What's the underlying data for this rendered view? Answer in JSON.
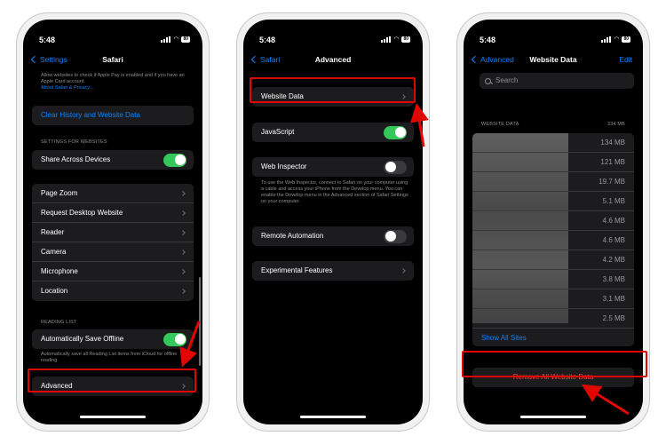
{
  "status": {
    "time": "5:48",
    "battery": "80"
  },
  "screen1": {
    "back_label": "Settings",
    "title": "Safari",
    "apple_pay_note": "Allow websites to check if Apple Pay is enabled and if you have an Apple Card account.",
    "apple_pay_link": "About Safari & Privacy…",
    "clear_history": "Clear History and Website Data",
    "settings_header": "SETTINGS FOR WEBSITES",
    "share_across_devices": "Share Across Devices",
    "website_items": [
      "Page Zoom",
      "Request Desktop Website",
      "Reader",
      "Camera",
      "Microphone",
      "Location"
    ],
    "reading_list_header": "READING LIST",
    "auto_save_offline": "Automatically Save Offline",
    "auto_save_note": "Automatically save all Reading List items from iCloud for offline reading.",
    "advanced": "Advanced",
    "share_toggle_on": true,
    "auto_save_toggle_on": true
  },
  "screen2": {
    "back_label": "Safari",
    "title": "Advanced",
    "website_data": "Website Data",
    "javascript": "JavaScript",
    "web_inspector": "Web Inspector",
    "web_inspector_note": "To use the Web Inspector, connect to Safari on your computer using a cable and access your iPhone from the Develop menu. You can enable the Develop menu in the Advanced section of Safari Settings on your computer.",
    "remote_automation": "Remote Automation",
    "experimental_features": "Experimental Features",
    "javascript_on": true,
    "web_inspector_on": false,
    "remote_automation_on": false
  },
  "screen3": {
    "back_label": "Advanced",
    "title": "Website Data",
    "edit_label": "Edit",
    "search_placeholder": "Search",
    "section_header": "WEBSITE DATA",
    "total": "334 MB",
    "sizes": [
      "134 MB",
      "121 MB",
      "19.7 MB",
      "5.1 MB",
      "4.6 MB",
      "4.6 MB",
      "4.2 MB",
      "3.8 MB",
      "3.1 MB",
      "2.5 MB"
    ],
    "show_all": "Show All Sites",
    "remove_all": "Remove All Website Data"
  },
  "colors": {
    "accent": "#0a84ff",
    "toggle_on": "#34c759",
    "highlight": "#e10600",
    "destructive": "#ff453a"
  }
}
